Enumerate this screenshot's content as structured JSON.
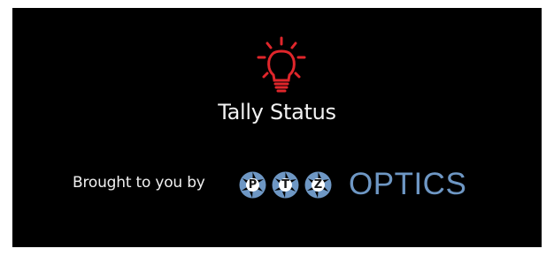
{
  "widget": {
    "title": "Tally Status",
    "credit_text": "Brought to you by",
    "bulb_icon": "lightbulb-icon",
    "accent_color": "#e0262b"
  },
  "logo": {
    "letters": [
      "P",
      "T",
      "Z"
    ],
    "wordmark": "OPTICS",
    "brand_color": "#6e97c4"
  }
}
